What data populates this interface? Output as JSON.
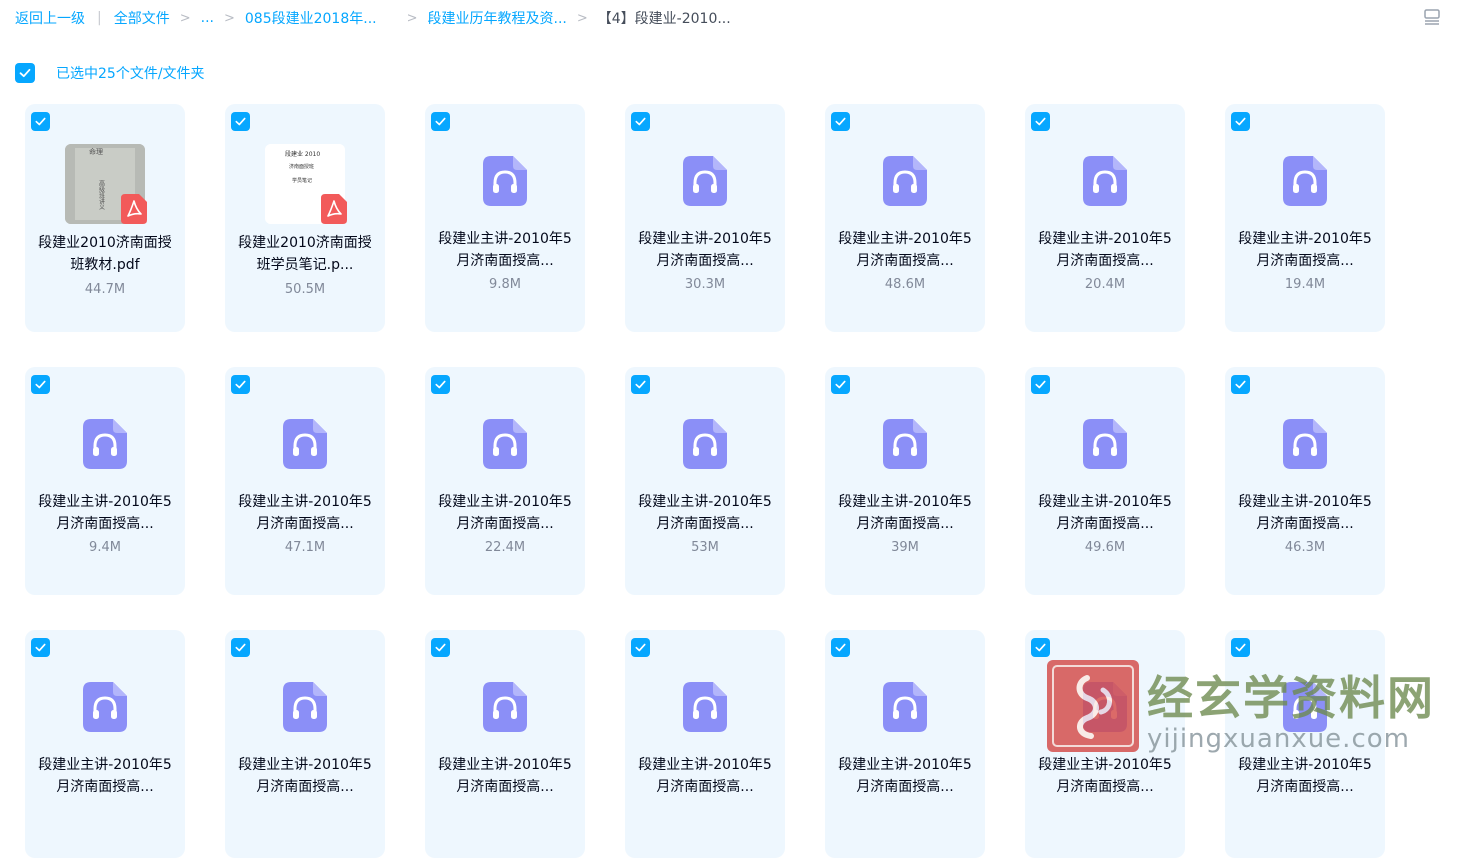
{
  "breadcrumb": {
    "back": "返回上一级",
    "all_files": "全部文件",
    "ellipsis": "...",
    "level1": "085段建业2018年...",
    "level2": "段建业历年教程及资...",
    "current": "【4】段建业-2010..."
  },
  "selection": {
    "label": "已选中25个文件/文件夹"
  },
  "files": [
    {
      "type": "pdf",
      "name": "段建业2010济南面授班教材.pdf",
      "size": "44.7M"
    },
    {
      "type": "pdf",
      "name": "段建业2010济南面授班学员笔记.p...",
      "size": "50.5M"
    },
    {
      "type": "audio",
      "name": "段建业主讲-2010年5月济南面授高...",
      "size": "9.8M"
    },
    {
      "type": "audio",
      "name": "段建业主讲-2010年5月济南面授高...",
      "size": "30.3M"
    },
    {
      "type": "audio",
      "name": "段建业主讲-2010年5月济南面授高...",
      "size": "48.6M"
    },
    {
      "type": "audio",
      "name": "段建业主讲-2010年5月济南面授高...",
      "size": "20.4M"
    },
    {
      "type": "audio",
      "name": "段建业主讲-2010年5月济南面授高...",
      "size": "19.4M"
    },
    {
      "type": "audio",
      "name": "段建业主讲-2010年5月济南面授高...",
      "size": "9.4M"
    },
    {
      "type": "audio",
      "name": "段建业主讲-2010年5月济南面授高...",
      "size": "47.1M"
    },
    {
      "type": "audio",
      "name": "段建业主讲-2010年5月济南面授高...",
      "size": "22.4M"
    },
    {
      "type": "audio",
      "name": "段建业主讲-2010年5月济南面授高...",
      "size": "53M"
    },
    {
      "type": "audio",
      "name": "段建业主讲-2010年5月济南面授高...",
      "size": "39M"
    },
    {
      "type": "audio",
      "name": "段建业主讲-2010年5月济南面授高...",
      "size": "49.6M"
    },
    {
      "type": "audio",
      "name": "段建业主讲-2010年5月济南面授高...",
      "size": "46.3M"
    },
    {
      "type": "audio",
      "name": "段建业主讲-2010年5月济南面授高...",
      "size": ""
    },
    {
      "type": "audio",
      "name": "段建业主讲-2010年5月济南面授高...",
      "size": ""
    },
    {
      "type": "audio",
      "name": "段建业主讲-2010年5月济南面授高...",
      "size": ""
    },
    {
      "type": "audio",
      "name": "段建业主讲-2010年5月济南面授高...",
      "size": ""
    },
    {
      "type": "audio",
      "name": "段建业主讲-2010年5月济南面授高...",
      "size": ""
    },
    {
      "type": "audio",
      "name": "段建业主讲-2010年5月济南面授高...",
      "size": ""
    },
    {
      "type": "audio",
      "name": "段建业主讲-2010年5月济南面授高...",
      "size": ""
    }
  ],
  "thumbnails": {
    "pdf1": [
      "命理",
      "高级班讲义"
    ],
    "pdf2": [
      "段建业 2010",
      "济南面授班",
      "学员笔记"
    ]
  },
  "watermark": {
    "title": "经玄学资料网",
    "url": "yijingxuanxue.com"
  },
  "colors": {
    "accent": "#06a7ff",
    "tile_bg": "#eef7fe",
    "audio_icon": "#8b8ff7",
    "pdf_badge": "#f25a5a"
  },
  "icons": {
    "view_toggle": "list-view-icon",
    "audio": "audio-file-icon",
    "pdf": "pdf-icon",
    "check": "check-icon"
  }
}
